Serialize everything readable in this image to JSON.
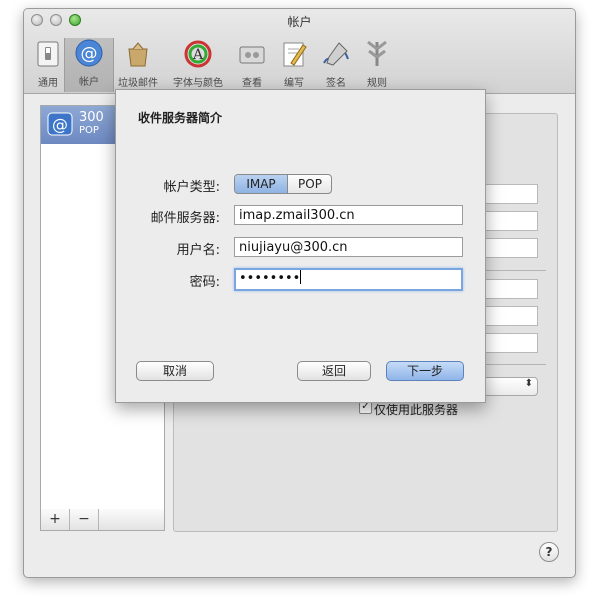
{
  "window": {
    "title": "帐户"
  },
  "toolbar": {
    "items": [
      {
        "label": "通用",
        "icon": "switch-icon"
      },
      {
        "label": "帐户",
        "icon": "at-icon",
        "active": true
      },
      {
        "label": "垃圾邮件",
        "icon": "trash-bag-icon"
      },
      {
        "label": "字体与颜色",
        "icon": "font-color-icon"
      },
      {
        "label": "查看",
        "icon": "view-icon"
      },
      {
        "label": "编写",
        "icon": "compose-icon"
      },
      {
        "label": "签名",
        "icon": "signature-icon"
      },
      {
        "label": "规则",
        "icon": "rules-icon"
      }
    ]
  },
  "accounts": [
    {
      "name": "300",
      "type": "POP"
    }
  ],
  "account_list_buttons": {
    "add": "+",
    "remove": "−"
  },
  "right_panel": {
    "checkbox_label": "仅使用此服务器",
    "checkbox_checked": true
  },
  "help": {
    "label": "?"
  },
  "sheet": {
    "title": "收件服务器简介",
    "account_type_label": "帐户类型:",
    "account_type_options": [
      "IMAP",
      "POP"
    ],
    "account_type_selected": "IMAP",
    "server_label": "邮件服务器:",
    "server_value": "imap.zmail300.cn",
    "username_label": "用户名:",
    "username_value": "niujiayu@300.cn",
    "password_label": "密码:",
    "password_value": "••••••••",
    "cancel_label": "取消",
    "back_label": "返回",
    "next_label": "下一步"
  },
  "colors": {
    "selection": "#6d89c1",
    "default_button": "#8fb5e9",
    "focus_ring": "#7aa5e0"
  }
}
